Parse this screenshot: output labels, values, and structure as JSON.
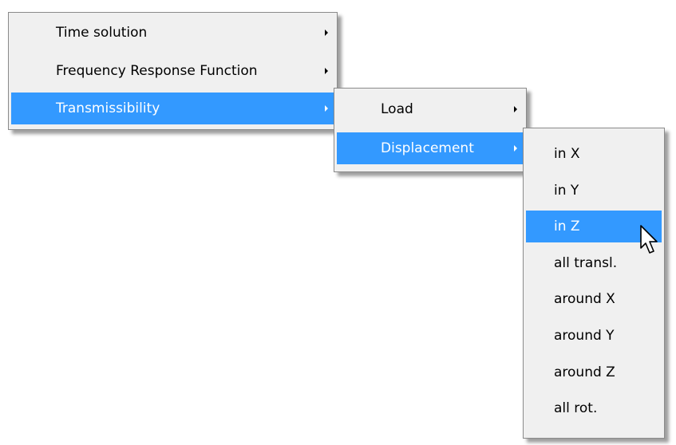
{
  "main_menu": {
    "items": [
      {
        "label": "Time solution"
      },
      {
        "label": "Frequency Response Function"
      },
      {
        "label": "Transmissibility"
      }
    ]
  },
  "transmissibility_menu": {
    "items": [
      {
        "label": "Load"
      },
      {
        "label": "Displacement"
      }
    ]
  },
  "displacement_menu": {
    "items": [
      {
        "label": "in X"
      },
      {
        "label": "in Y"
      },
      {
        "label": "in Z"
      },
      {
        "label": "all transl."
      },
      {
        "label": "around X"
      },
      {
        "label": "around Y"
      },
      {
        "label": "around Z"
      },
      {
        "label": "all rot."
      }
    ]
  },
  "colors": {
    "highlight": "#3399ff",
    "menu_background": "#f0f0f0",
    "menu_border": "#8a8a8a"
  },
  "icons": {
    "submenu_arrow": "chevron-right-icon",
    "cursor": "mouse-pointer-icon"
  }
}
